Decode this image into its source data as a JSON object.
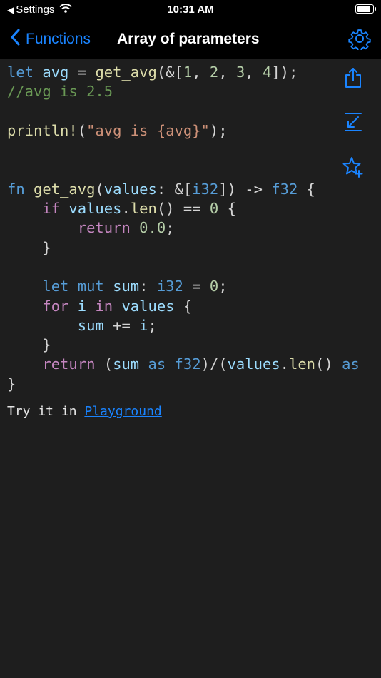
{
  "status_bar": {
    "back_app": "Settings",
    "time": "10:31 AM",
    "battery_level": 0.9
  },
  "nav": {
    "back_label": "Functions",
    "title": "Array of parameters"
  },
  "icons": {
    "back": "chevron-left-icon",
    "settings": "gear-icon",
    "share": "share-icon",
    "collapse": "arrow-down-left-icon",
    "favorite": "star-plus-icon"
  },
  "code": {
    "lines": [
      [
        {
          "t": "let ",
          "c": "kw"
        },
        {
          "t": "avg",
          "c": "var"
        },
        {
          "t": " = ",
          "c": ""
        },
        {
          "t": "get_avg",
          "c": "fn"
        },
        {
          "t": "(&[",
          "c": ""
        },
        {
          "t": "1",
          "c": "num"
        },
        {
          "t": ", ",
          "c": ""
        },
        {
          "t": "2",
          "c": "num"
        },
        {
          "t": ", ",
          "c": ""
        },
        {
          "t": "3",
          "c": "num"
        },
        {
          "t": ", ",
          "c": ""
        },
        {
          "t": "4",
          "c": "num"
        },
        {
          "t": "]);",
          "c": ""
        }
      ],
      [
        {
          "t": "//avg is 2.5",
          "c": "cmt"
        }
      ],
      [],
      [
        {
          "t": "println!",
          "c": "fn"
        },
        {
          "t": "(",
          "c": ""
        },
        {
          "t": "\"avg is {avg}\"",
          "c": "str"
        },
        {
          "t": ");",
          "c": ""
        }
      ],
      [],
      [],
      [
        {
          "t": "fn ",
          "c": "kw"
        },
        {
          "t": "get_avg",
          "c": "fn"
        },
        {
          "t": "(",
          "c": ""
        },
        {
          "t": "values",
          "c": "var"
        },
        {
          "t": ": &[",
          "c": ""
        },
        {
          "t": "i32",
          "c": "kw"
        },
        {
          "t": "]) -> ",
          "c": ""
        },
        {
          "t": "f32",
          "c": "kw"
        },
        {
          "t": " {",
          "c": ""
        }
      ],
      [
        {
          "t": "    ",
          "c": ""
        },
        {
          "t": "if ",
          "c": "ctl"
        },
        {
          "t": "values",
          "c": "var"
        },
        {
          "t": ".",
          "c": ""
        },
        {
          "t": "len",
          "c": "fn"
        },
        {
          "t": "() == ",
          "c": ""
        },
        {
          "t": "0",
          "c": "num"
        },
        {
          "t": " {",
          "c": ""
        }
      ],
      [
        {
          "t": "        ",
          "c": ""
        },
        {
          "t": "return ",
          "c": "ctl"
        },
        {
          "t": "0.0",
          "c": "num"
        },
        {
          "t": ";",
          "c": ""
        }
      ],
      [
        {
          "t": "    }",
          "c": ""
        }
      ],
      [],
      [
        {
          "t": "    ",
          "c": ""
        },
        {
          "t": "let ",
          "c": "kw"
        },
        {
          "t": "mut ",
          "c": "kw"
        },
        {
          "t": "sum",
          "c": "var"
        },
        {
          "t": ": ",
          "c": ""
        },
        {
          "t": "i32",
          "c": "kw"
        },
        {
          "t": " = ",
          "c": ""
        },
        {
          "t": "0",
          "c": "num"
        },
        {
          "t": ";",
          "c": ""
        }
      ],
      [
        {
          "t": "    ",
          "c": ""
        },
        {
          "t": "for ",
          "c": "ctl"
        },
        {
          "t": "i ",
          "c": "var"
        },
        {
          "t": "in ",
          "c": "ctl"
        },
        {
          "t": "values",
          "c": "var"
        },
        {
          "t": " {",
          "c": ""
        }
      ],
      [
        {
          "t": "        ",
          "c": ""
        },
        {
          "t": "sum",
          "c": "var"
        },
        {
          "t": " += ",
          "c": ""
        },
        {
          "t": "i",
          "c": "var"
        },
        {
          "t": ";",
          "c": ""
        }
      ],
      [
        {
          "t": "    }",
          "c": ""
        }
      ],
      [
        {
          "t": "    ",
          "c": ""
        },
        {
          "t": "return ",
          "c": "ctl"
        },
        {
          "t": "(",
          "c": ""
        },
        {
          "t": "sum ",
          "c": "var"
        },
        {
          "t": "as ",
          "c": "kw"
        },
        {
          "t": "f32",
          "c": "kw"
        },
        {
          "t": ")/(",
          "c": ""
        },
        {
          "t": "values",
          "c": "var"
        },
        {
          "t": ".",
          "c": ""
        },
        {
          "t": "len",
          "c": "fn"
        },
        {
          "t": "() ",
          "c": ""
        },
        {
          "t": "as",
          "c": "kw"
        }
      ],
      [
        {
          "t": "}",
          "c": ""
        }
      ]
    ]
  },
  "footer": {
    "prefix": "Try it in ",
    "link": "Playground"
  }
}
